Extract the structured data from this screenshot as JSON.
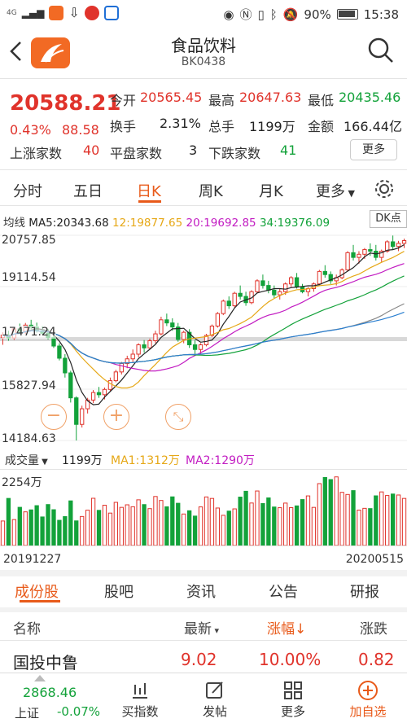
{
  "status_bar": {
    "battery": "90%",
    "time": "15:38",
    "network": "4G"
  },
  "header": {
    "title": "食品饮料",
    "code": "BK0438"
  },
  "quote": {
    "price": "20588.21",
    "change_pct": "0.43%",
    "change_amt": "88.58",
    "rows": [
      [
        {
          "label": "今开",
          "value": "20565.45",
          "color": "red"
        },
        {
          "label": "最高",
          "value": "20647.63",
          "color": "red"
        },
        {
          "label": "最低",
          "value": "20435.46",
          "color": "green"
        }
      ],
      [
        {
          "label": "换手",
          "value": "2.31%",
          "color": "black"
        },
        {
          "label": "总手",
          "value": "1199万",
          "color": "black"
        },
        {
          "label": "金额",
          "value": "166.44亿",
          "color": "black"
        }
      ],
      [
        {
          "label": "上涨家数",
          "value": "40",
          "color": "red"
        },
        {
          "label": "平盘家数",
          "value": "3",
          "color": "black"
        },
        {
          "label": "下跌家数",
          "value": "41",
          "color": "green"
        }
      ]
    ],
    "more_label": "更多"
  },
  "period_tabs": [
    "分时",
    "五日",
    "日K",
    "周K",
    "月K",
    "更多"
  ],
  "active_period": "日K",
  "ma_line": {
    "label": "均线",
    "ma5": "MA5:20343.68",
    "ma12": "12:19877.65",
    "ma20": "20:19692.85",
    "ma34": "34:19376.09",
    "dk": "DK点"
  },
  "y_axis_labels": [
    "20757.85",
    "19114.54",
    "17471.24",
    "15827.94",
    "14184.63"
  ],
  "volume": {
    "selector": "成交量",
    "value": "1199万",
    "ma1": "MA1:1312万",
    "ma2": "MA2:1290万",
    "max_label": "2254万"
  },
  "dates": {
    "start": "20191227",
    "end": "20200515"
  },
  "bottom_tabs": [
    "成份股",
    "股吧",
    "资讯",
    "公告",
    "研报"
  ],
  "table_header": {
    "name": "名称",
    "latest": "最新",
    "change_pct": "涨幅↓",
    "change_amt": "涨跌"
  },
  "first_row": {
    "name": "国投中鲁",
    "latest": "9.02",
    "change_pct": "10.00%",
    "change_amt": "0.82"
  },
  "footer": {
    "index_value": "2868.46",
    "index_name": "上证",
    "index_change": "-0.07%",
    "buttons": [
      "买指数",
      "发帖",
      "更多",
      "加自选"
    ]
  },
  "colors": {
    "up": "#e0332b",
    "down": "#13a23a",
    "accent": "#e85a1a"
  },
  "chart_data": {
    "type": "candlestick",
    "price_range": [
      14184.63,
      20757.85
    ],
    "ohlc": [
      [
        17480,
        17650,
        17250,
        17560
      ],
      [
        17560,
        17700,
        17380,
        17470
      ],
      [
        17470,
        17820,
        17410,
        17760
      ],
      [
        17760,
        17930,
        17620,
        17680
      ],
      [
        17680,
        17950,
        17600,
        17880
      ],
      [
        17880,
        18050,
        17750,
        17820
      ],
      [
        17820,
        17960,
        17640,
        17700
      ],
      [
        17700,
        17850,
        17550,
        17620
      ],
      [
        17620,
        17760,
        17420,
        17480
      ],
      [
        17480,
        17560,
        17150,
        17210
      ],
      [
        17210,
        17300,
        16750,
        16820
      ],
      [
        16820,
        16950,
        16200,
        16350
      ],
      [
        16350,
        16420,
        15400,
        15550
      ],
      [
        15550,
        15600,
        14184,
        14700
      ],
      [
        14700,
        15300,
        14600,
        15200
      ],
      [
        15200,
        15550,
        15050,
        15480
      ],
      [
        15480,
        15800,
        15380,
        15720
      ],
      [
        15720,
        15900,
        15550,
        15650
      ],
      [
        15650,
        15880,
        15500,
        15820
      ],
      [
        15820,
        16200,
        15750,
        16100
      ],
      [
        16100,
        16450,
        16050,
        16380
      ],
      [
        16380,
        16700,
        16300,
        16650
      ],
      [
        16650,
        16900,
        16500,
        16800
      ],
      [
        16800,
        17100,
        16700,
        16950
      ],
      [
        16950,
        17300,
        16850,
        17250
      ],
      [
        17250,
        17400,
        17000,
        17150
      ],
      [
        17150,
        17450,
        17100,
        17380
      ],
      [
        17380,
        17700,
        17300,
        17600
      ],
      [
        17600,
        18150,
        17550,
        18050
      ],
      [
        18050,
        18250,
        17850,
        17950
      ],
      [
        17950,
        18100,
        17700,
        17820
      ],
      [
        17820,
        17950,
        17350,
        17420
      ],
      [
        17420,
        17700,
        17300,
        17650
      ],
      [
        17650,
        17750,
        17150,
        17250
      ],
      [
        17250,
        17400,
        16900,
        17100
      ],
      [
        17100,
        17300,
        16950,
        17250
      ],
      [
        17250,
        17600,
        17200,
        17550
      ],
      [
        17550,
        17900,
        17500,
        17850
      ],
      [
        17850,
        18300,
        17800,
        18250
      ],
      [
        18250,
        18700,
        18200,
        18650
      ],
      [
        18650,
        18800,
        18400,
        18500
      ],
      [
        18500,
        18950,
        18450,
        18900
      ],
      [
        18900,
        19150,
        18700,
        18800
      ],
      [
        18800,
        18950,
        18500,
        18600
      ],
      [
        18600,
        19000,
        18550,
        18950
      ],
      [
        18950,
        19350,
        18900,
        19300
      ],
      [
        19300,
        19500,
        19050,
        19150
      ],
      [
        19150,
        19300,
        18900,
        19000
      ],
      [
        19000,
        19150,
        18750,
        18850
      ],
      [
        18850,
        19050,
        18700,
        18950
      ],
      [
        18950,
        19250,
        18850,
        19200
      ],
      [
        19200,
        19450,
        19100,
        19400
      ],
      [
        19400,
        19550,
        19050,
        19100
      ],
      [
        19100,
        19200,
        18900,
        18950
      ],
      [
        18950,
        19100,
        18800,
        19050
      ],
      [
        19050,
        19250,
        18950,
        19200
      ],
      [
        19200,
        19650,
        19150,
        19600
      ],
      [
        19600,
        19800,
        19400,
        19500
      ],
      [
        19500,
        19600,
        19200,
        19300
      ],
      [
        19300,
        19500,
        19150,
        19400
      ],
      [
        19400,
        19700,
        19350,
        19650
      ],
      [
        19650,
        20250,
        19600,
        20200
      ],
      [
        20200,
        20450,
        19950,
        20050
      ],
      [
        20050,
        20250,
        19850,
        20150
      ],
      [
        20150,
        20350,
        20000,
        20300
      ],
      [
        20300,
        20500,
        20100,
        20250
      ],
      [
        20250,
        20450,
        19950,
        20050
      ],
      [
        20050,
        20300,
        19900,
        20250
      ],
      [
        20250,
        20600,
        20200,
        20550
      ],
      [
        20550,
        20750,
        20300,
        20400
      ],
      [
        20400,
        20580,
        20250,
        20500
      ],
      [
        20500,
        20650,
        20350,
        20588
      ]
    ],
    "volume_max": "2254万"
  }
}
